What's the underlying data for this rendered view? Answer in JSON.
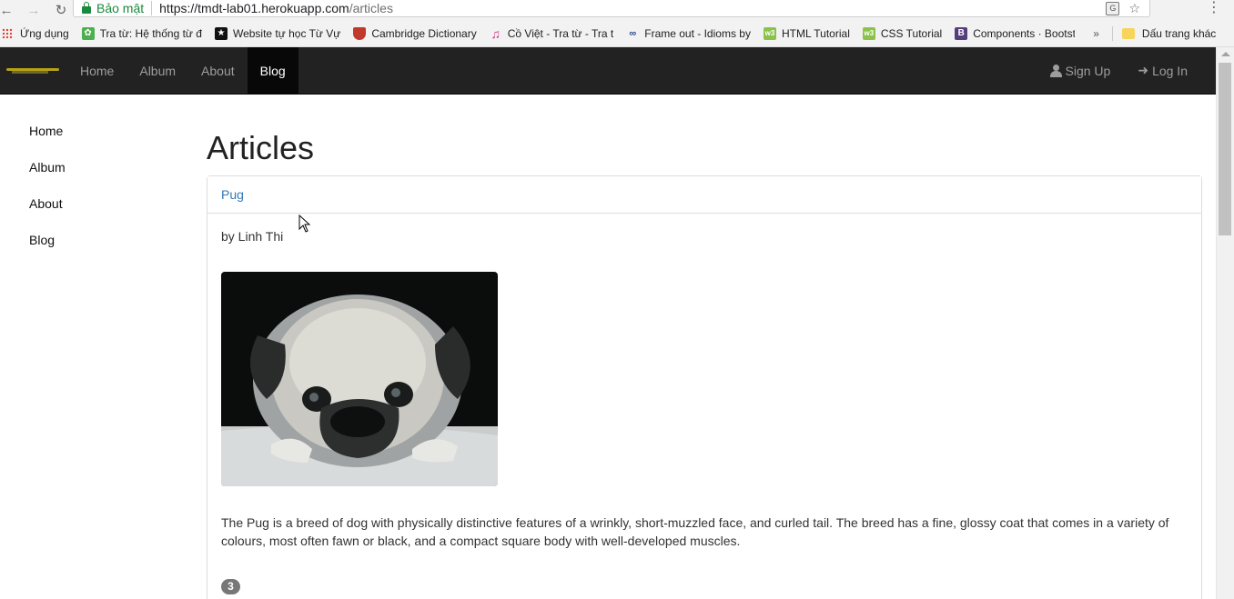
{
  "browser": {
    "secure_label": "Bảo mật",
    "url_host": "https://tmdt-lab01.herokuapp.com",
    "url_path": "/articles",
    "bookmarks": [
      {
        "label": "Ứng dụng",
        "icon": "apps-grid-icon"
      },
      {
        "label": "Tra từ: Hệ thống từ đ",
        "icon": "leaf-icon",
        "color": "#4caf50"
      },
      {
        "label": "Website tự học Từ Vự",
        "icon": "star-icon",
        "color": "#111111"
      },
      {
        "label": "Cambridge Dictionary",
        "icon": "shield-icon",
        "color": "#c0392b"
      },
      {
        "label": "Cồ Việt - Tra từ - Tra t",
        "icon": "music-note-icon",
        "color": "#d63384"
      },
      {
        "label": "Frame out - Idioms by",
        "icon": "idioms-icon",
        "color": "#2c4a8a"
      },
      {
        "label": "HTML Tutorial",
        "icon": "w3-icon",
        "color": "#8bc34a"
      },
      {
        "label": "CSS Tutorial",
        "icon": "w3-icon",
        "color": "#8bc34a"
      },
      {
        "label": "Components · Bootstr",
        "icon": "bootstrap-icon",
        "color": "#563d7c"
      }
    ],
    "more_bookmarks": "»",
    "other_bookmarks": "Dấu trang khác"
  },
  "navbar": {
    "links": [
      "Home",
      "Album",
      "About",
      "Blog"
    ],
    "active": "Blog",
    "signup": "Sign Up",
    "login": "Log In"
  },
  "sidebar": {
    "links": [
      "Home",
      "Album",
      "About",
      "Blog"
    ]
  },
  "main": {
    "title": "Articles",
    "article": {
      "title": "Pug",
      "author": "by Linh Thi",
      "image_subject": "pug dog lying down",
      "description": "The Pug is a breed of dog with physically distinctive features of a wrinkly, short-muzzled face, and curled tail. The breed has a fine, glossy coat that comes in a variety of colours, most often fawn or black, and a compact square body with well-developed muscles.",
      "badge": "3"
    }
  },
  "colors": {
    "navbar_bg": "#222222",
    "link": "#337ab7",
    "secure": "#1a8a3c",
    "badge": "#777777"
  }
}
